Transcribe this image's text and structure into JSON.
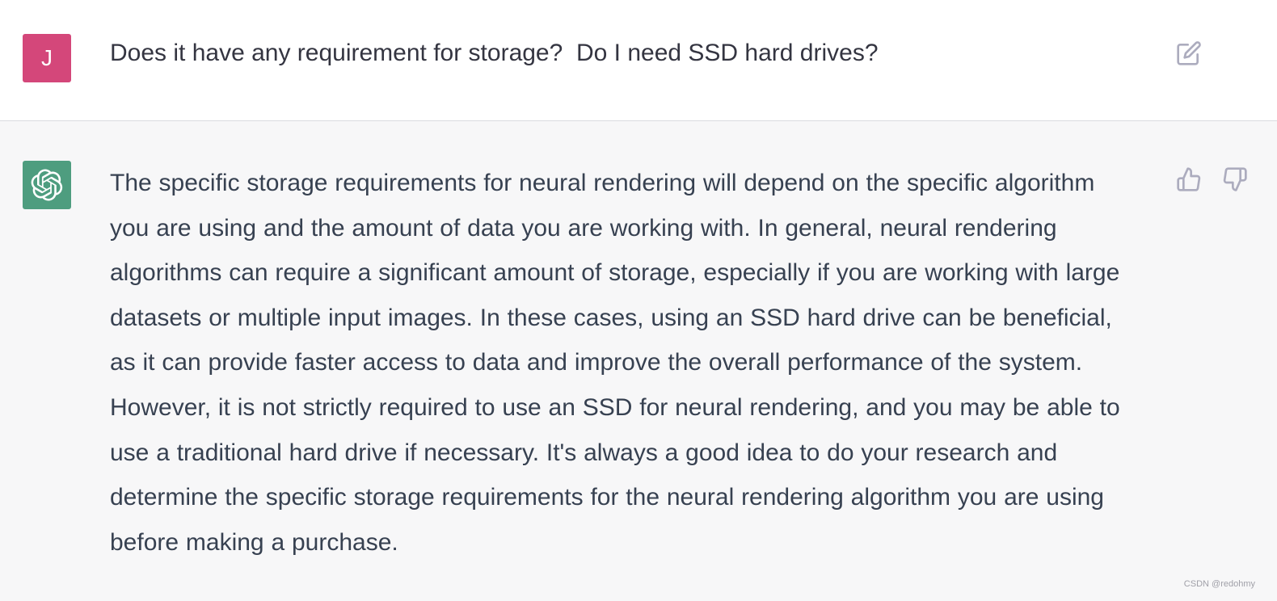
{
  "user_turn": {
    "avatar_letter": "J",
    "message": "Does it have any requirement for storage?  Do I need SSD hard drives?",
    "edit_icon": "edit-icon",
    "avatar_color": "#d4477a"
  },
  "assistant_turn": {
    "avatar_icon": "openai-logo-icon",
    "avatar_color": "#4e9d7f",
    "message": "The specific storage requirements for neural rendering will depend on the specific algorithm you are using and the amount of data you are working with. In general, neural rendering algorithms can require a significant amount of storage, especially if you are working with large datasets or multiple input images. In these cases, using an SSD hard drive can be beneficial, as it can provide faster access to data and improve the overall performance of the system. However, it is not strictly required to use an SSD for neural rendering, and you may be able to use a traditional hard drive if necessary. It's always a good idea to do your research and determine the specific storage requirements for the neural rendering algorithm you are using before making a purchase.",
    "feedback_icons": [
      "thumbs-up-icon",
      "thumbs-down-icon"
    ]
  },
  "watermark": "CSDN @redohmy",
  "colors": {
    "assistant_background": "#f7f7f8",
    "icon_gray": "#acacbe",
    "text": "#374151"
  }
}
